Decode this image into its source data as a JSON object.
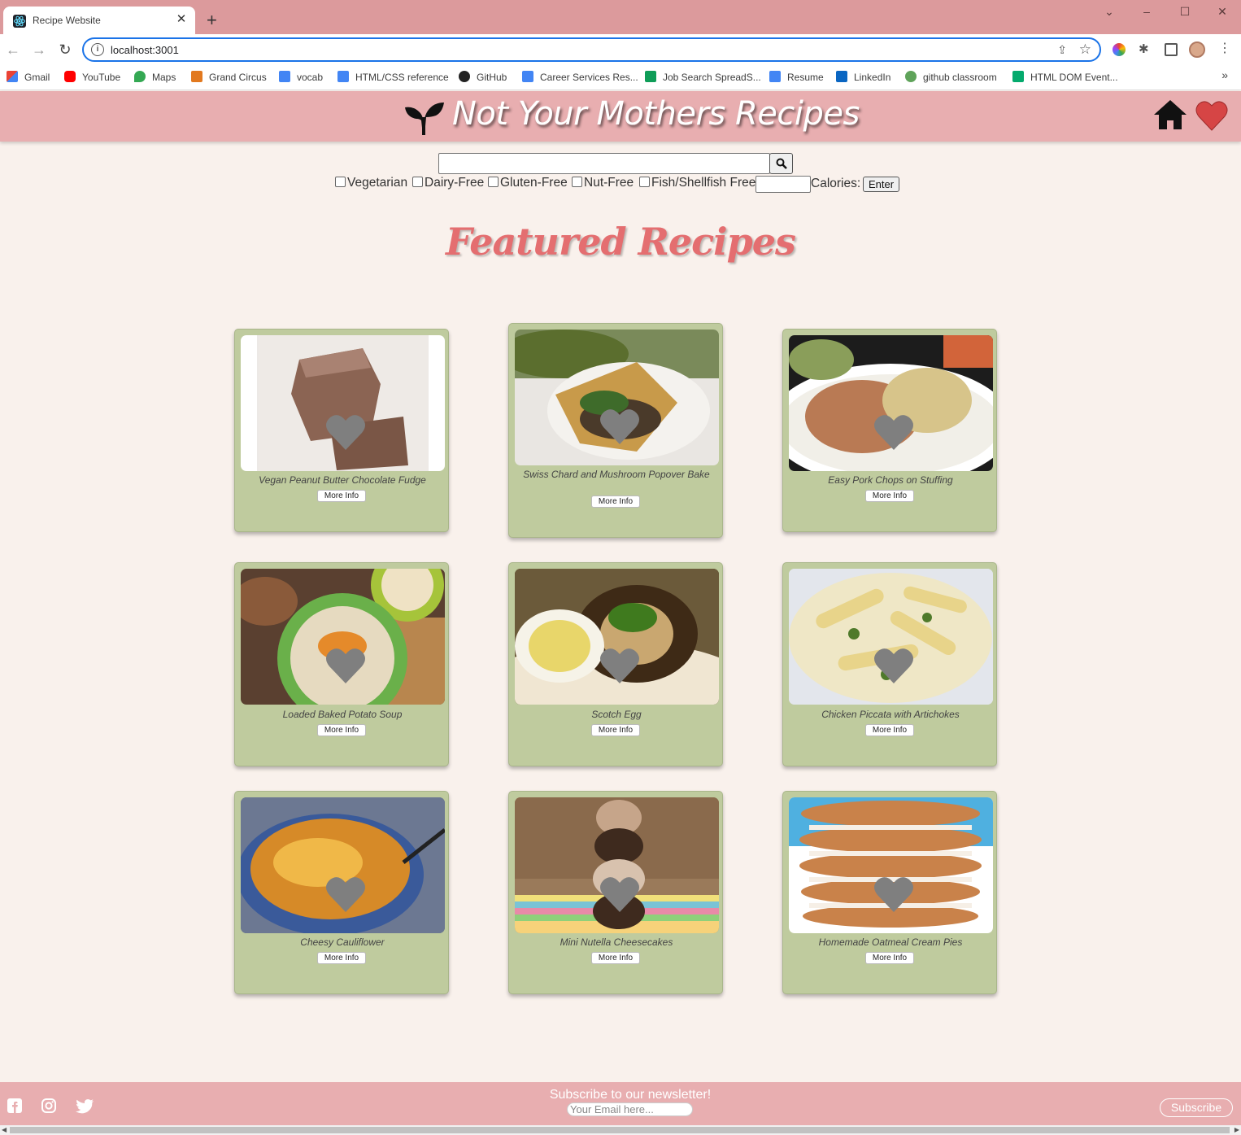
{
  "browser": {
    "tab_title": "Recipe Website",
    "url": "localhost:3001",
    "bookmarks": [
      {
        "label": "Gmail"
      },
      {
        "label": "YouTube"
      },
      {
        "label": "Maps"
      },
      {
        "label": "Grand Circus"
      },
      {
        "label": "vocab"
      },
      {
        "label": "HTML/CSS reference"
      },
      {
        "label": "GitHub"
      },
      {
        "label": "Career Services Res..."
      },
      {
        "label": "Job Search SpreadS..."
      },
      {
        "label": "Resume"
      },
      {
        "label": "LinkedIn"
      },
      {
        "label": "github classroom"
      },
      {
        "label": "HTML DOM Event..."
      }
    ],
    "colors": {
      "tabstrip": "#dc9a9c",
      "omnibox_border": "#1a73e8"
    }
  },
  "header": {
    "title": "Not Your Mothers Recipes",
    "icons": [
      "sprout-icon",
      "home-icon",
      "heart-icon"
    ],
    "colors": {
      "background": "#e8aeb0",
      "favorite_heart": "#d64545"
    }
  },
  "search": {
    "query": "",
    "button_icon": "search-icon",
    "filters": [
      {
        "label": "Vegetarian",
        "checked": false
      },
      {
        "label": "Dairy-Free",
        "checked": false
      },
      {
        "label": "Gluten-Free",
        "checked": false
      },
      {
        "label": "Nut-Free",
        "checked": false
      },
      {
        "label": "Fish/Shellfish Free",
        "checked": false
      }
    ],
    "calories_value": "",
    "calories_label": "Calories:",
    "enter_label": "Enter"
  },
  "featured": {
    "title": "Featured Recipes",
    "more_info_label": "More Info",
    "recipes": [
      {
        "name": "Vegan Peanut Butter Chocolate Fudge"
      },
      {
        "name": "Swiss Chard and Mushroom Popover Bake"
      },
      {
        "name": "Easy Pork Chops on Stuffing"
      },
      {
        "name": "Loaded Baked Potato Soup"
      },
      {
        "name": "Scotch Egg"
      },
      {
        "name": "Chicken Piccata with Artichokes"
      },
      {
        "name": "Cheesy Cauliflower"
      },
      {
        "name": "Mini Nutella Cheesecakes"
      },
      {
        "name": "Homemade Oatmeal Cream Pies"
      }
    ],
    "colors": {
      "card": "#bfcb9e",
      "title": "#e46e70",
      "favorite_heart": "#7f7f7f"
    }
  },
  "footer": {
    "newsletter_title": "Subscribe to our newsletter!",
    "email_placeholder": "Your Email here...",
    "subscribe_label": "Subscribe",
    "social_icons": [
      "facebook-icon",
      "instagram-icon",
      "twitter-icon"
    ]
  }
}
